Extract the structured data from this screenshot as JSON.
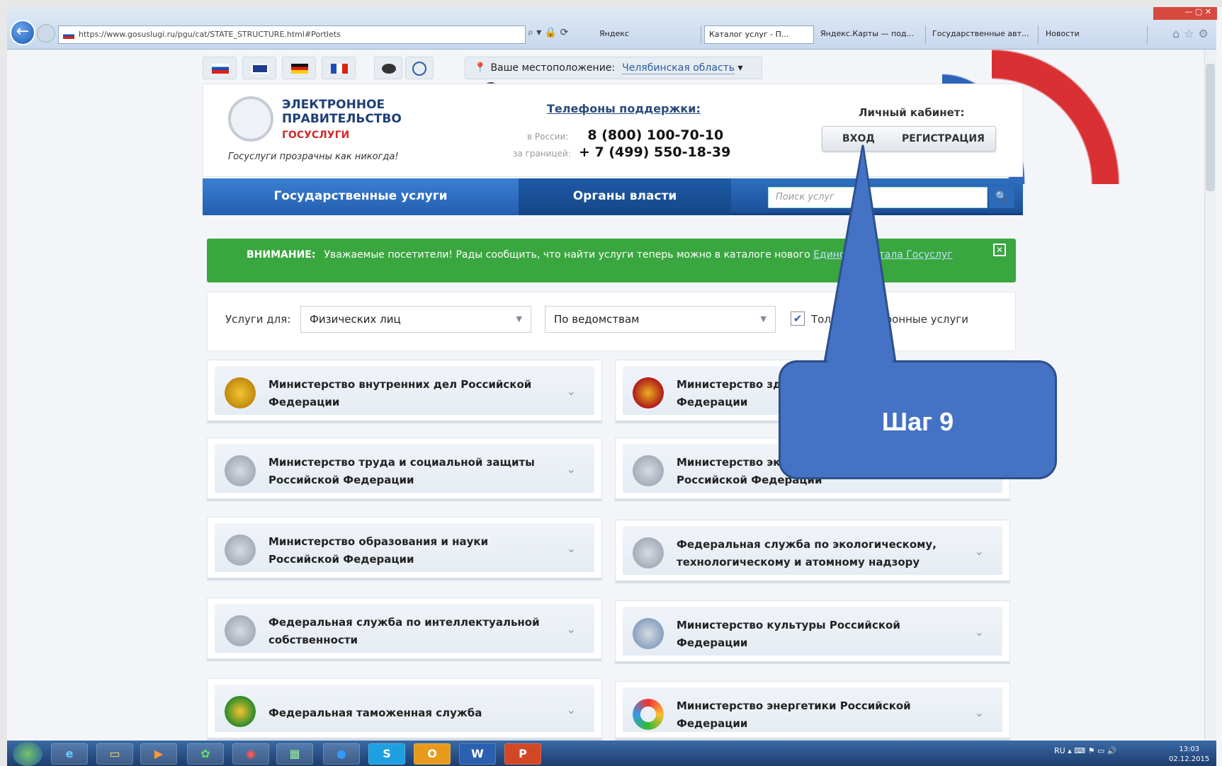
{
  "browser": {
    "url": "https://www.gosuslugi.ru/pgu/cat/STATE_STRUCTURE.html#Portlets",
    "tabs": [
      "Яндекс",
      "Каталог услуг - П...",
      "Яндекс.Карты — под...",
      "Государственные авт...",
      "Новости"
    ]
  },
  "header": {
    "location_label": "Ваше местоположение:",
    "location_value": "Челябинская область",
    "logo_line1": "ЭЛЕКТРОННОЕ",
    "logo_line2": "ПРАВИТЕЛЬСТВО",
    "logo_line3": "ГОСУСЛУГИ",
    "slogan": "Госуслуги прозрачны как никогда!",
    "support_title": "Телефоны поддержки:",
    "phone_ru_label": "в России:",
    "phone_ru": "8 (800) 100-70-10",
    "phone_abroad_label": "за границей:",
    "phone_abroad": "+ 7 (499) 550-18-39",
    "cabinet_title": "Личный кабинет:",
    "login": "ВХОД",
    "register": "РЕГИСТРАЦИЯ"
  },
  "nav": {
    "services": "Государственные услуги",
    "authorities": "Органы власти",
    "search_placeholder": "Поиск услуг"
  },
  "alert": {
    "title": "ВНИМАНИЕ:",
    "text": "Уважаемые посетители! Рады сообщить, что найти услуги теперь можно в каталоге нового",
    "link": "Единого портала Госуслуг"
  },
  "filter": {
    "label": "Услуги для:",
    "audience": "Физических лиц",
    "grouping": "По ведомствам",
    "checkbox_label": "Только электронные услуги"
  },
  "cards": [
    {
      "title": "Министерство внутренних дел Российской Федерации"
    },
    {
      "title": "Министерство здравоохранения Российской Федерации"
    },
    {
      "title": "Министерство труда и социальной защиты Российской Федерации"
    },
    {
      "title": "Министерство экономического развития Российской Федерации"
    },
    {
      "title": "Министерство образования и науки Российской Федерации"
    },
    {
      "title": "Федеральная служба по экологическому, технологическому и атомному надзору"
    },
    {
      "title": "Федеральная служба по интеллектуальной собственности"
    },
    {
      "title": "Министерство культуры Российской Федерации"
    },
    {
      "title": "Федеральная таможенная служба"
    },
    {
      "title": "Министерство энергетики Российской Федерации"
    }
  ],
  "callout": {
    "text": "Шаг 9"
  },
  "taskbar": {
    "lang": "RU",
    "time": "13:03",
    "date": "02.12.2015"
  },
  "colors": {
    "accent": "#4472c4",
    "alert_green": "#3aa640",
    "nav_blue": "#245fb0"
  }
}
